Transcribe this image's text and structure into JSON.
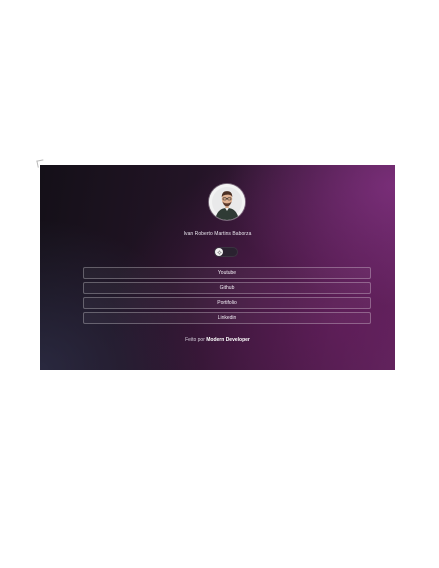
{
  "profile": {
    "name": "Ivan Roberto Martins Baborza",
    "avatar_icon": "user-avatar-icon"
  },
  "theme_toggle": {
    "icon": "sun-icon",
    "state": "off"
  },
  "links": [
    {
      "label": "Youtube"
    },
    {
      "label": "Github"
    },
    {
      "label": "Portifolio"
    },
    {
      "label": "Linkedin"
    }
  ],
  "footer": {
    "prefix": "Feito por",
    "author": "Modern Developer"
  },
  "colors": {
    "background_dark": "#141018",
    "accent_purple": "#5a2658",
    "text": "#f2eef5"
  }
}
